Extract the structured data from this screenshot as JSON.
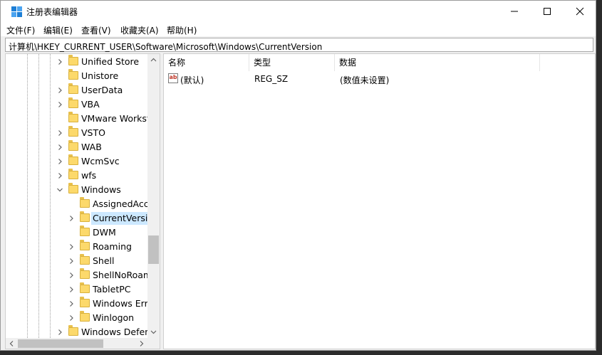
{
  "window": {
    "title": "注册表编辑器",
    "controls": [
      "minimize-icon",
      "maximize-icon",
      "close-icon"
    ]
  },
  "menu": [
    "文件(F)",
    "编辑(E)",
    "查看(V)",
    "收藏夹(A)",
    "帮助(H)"
  ],
  "address": "计算机\\HKEY_CURRENT_USER\\Software\\Microsoft\\Windows\\CurrentVersion",
  "tree": {
    "items": [
      {
        "label": "Unified Store",
        "level": 1,
        "chevron": "right"
      },
      {
        "label": "Unistore",
        "level": 1,
        "chevron": "none"
      },
      {
        "label": "UserData",
        "level": 1,
        "chevron": "right"
      },
      {
        "label": "VBA",
        "level": 1,
        "chevron": "right"
      },
      {
        "label": "VMware Workst",
        "level": 1,
        "chevron": "none"
      },
      {
        "label": "VSTO",
        "level": 1,
        "chevron": "right"
      },
      {
        "label": "WAB",
        "level": 1,
        "chevron": "right"
      },
      {
        "label": "WcmSvc",
        "level": 1,
        "chevron": "right"
      },
      {
        "label": "wfs",
        "level": 1,
        "chevron": "right"
      },
      {
        "label": "Windows",
        "level": 1,
        "chevron": "down"
      },
      {
        "label": "AssignedAcce",
        "level": 2,
        "chevron": "none"
      },
      {
        "label": "CurrentVersio",
        "level": 2,
        "chevron": "right",
        "selected": true
      },
      {
        "label": "DWM",
        "level": 2,
        "chevron": "none"
      },
      {
        "label": "Roaming",
        "level": 2,
        "chevron": "right"
      },
      {
        "label": "Shell",
        "level": 2,
        "chevron": "right"
      },
      {
        "label": "ShellNoRoam",
        "level": 2,
        "chevron": "right"
      },
      {
        "label": "TabletPC",
        "level": 2,
        "chevron": "right"
      },
      {
        "label": "Windows Erro",
        "level": 2,
        "chevron": "right"
      },
      {
        "label": "Winlogon",
        "level": 2,
        "chevron": "right"
      },
      {
        "label": "Windows Defen",
        "level": 1,
        "chevron": "right"
      }
    ]
  },
  "list": {
    "columns": [
      "名称",
      "类型",
      "数据"
    ],
    "rows": [
      {
        "name": "(默认)",
        "type": "REG_SZ",
        "data": "(数值未设置)",
        "icon": "string-value-icon",
        "icon_text": "ab"
      }
    ]
  }
}
